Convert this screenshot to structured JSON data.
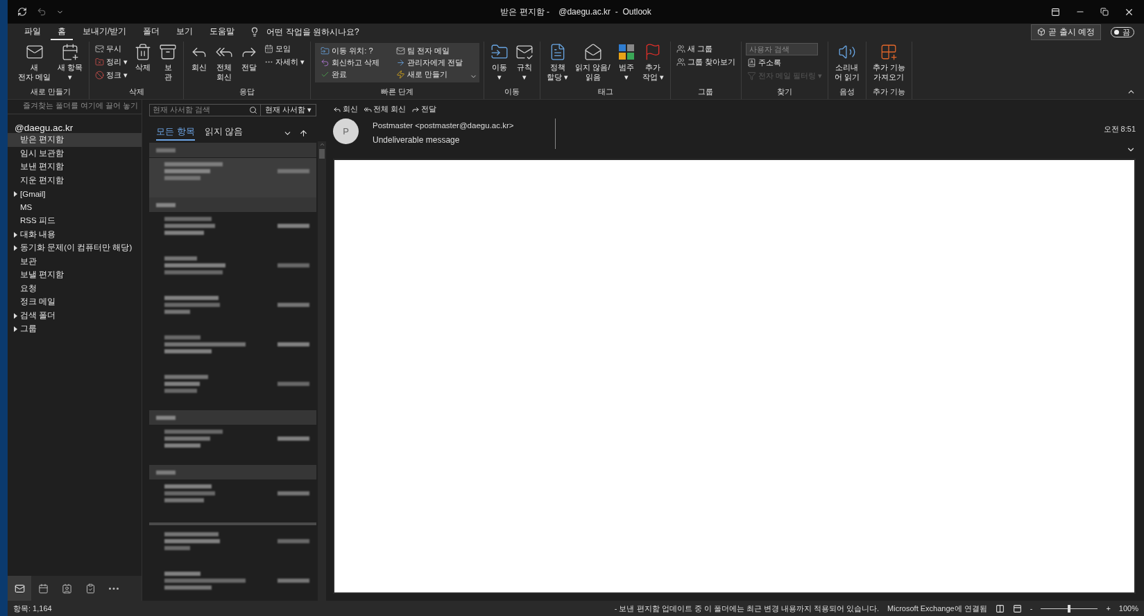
{
  "window": {
    "title": "받은 편지함 -    @daegu.ac.kr  -  Outlook"
  },
  "menu": [
    {
      "label": "파일",
      "selected": false
    },
    {
      "label": "홈",
      "selected": true
    },
    {
      "label": "보내기/받기",
      "selected": false
    },
    {
      "label": "폴더",
      "selected": false
    },
    {
      "label": "보기",
      "selected": false
    },
    {
      "label": "도움말",
      "selected": false
    }
  ],
  "tell_me": "어떤 작업을 원하시나요?",
  "coming_soon": {
    "label": "곧 출시 예정",
    "toggle_label": "끔",
    "on": false
  },
  "ribbon": [
    {
      "label": "새로 만들기",
      "items": [
        {
          "kind": "large",
          "label": "새\n전자 메일"
        },
        {
          "kind": "large",
          "label": "새 항목\n▾"
        }
      ]
    },
    {
      "label": "삭제",
      "items": [
        {
          "kind": "small",
          "label": "무시"
        },
        {
          "kind": "small",
          "label": "정리 ▾"
        },
        {
          "kind": "small",
          "label": "정크 ▾"
        },
        {
          "kind": "large",
          "label": "삭제"
        },
        {
          "kind": "large",
          "label": "보\n관"
        }
      ]
    },
    {
      "label": "응답",
      "items": [
        {
          "kind": "large",
          "label": "회신"
        },
        {
          "kind": "large",
          "label": "전체\n회신"
        },
        {
          "kind": "large",
          "label": "전달"
        },
        {
          "kind": "small",
          "label": "모임"
        },
        {
          "kind": "small",
          "label": "자세히 ▾"
        }
      ]
    },
    {
      "label": "빠른 단계",
      "items": [
        {
          "kind": "step",
          "label": "이동 위치: ?"
        },
        {
          "kind": "step",
          "label": "팀 전자 메일"
        },
        {
          "kind": "step",
          "label": "회신하고 삭제"
        },
        {
          "kind": "step",
          "label": "관리자에게 전달"
        },
        {
          "kind": "step",
          "label": "완료"
        },
        {
          "kind": "step",
          "label": "새로 만들기"
        }
      ]
    },
    {
      "label": "이동",
      "items": [
        {
          "kind": "large",
          "label": "이동\n▾"
        },
        {
          "kind": "large",
          "label": "규칙\n▾"
        }
      ]
    },
    {
      "label": "태그",
      "items": [
        {
          "kind": "large",
          "label": "정책\n할당 ▾"
        },
        {
          "kind": "large",
          "label": "읽지 않음/\n읽음"
        },
        {
          "kind": "large",
          "label": "범주\n▾"
        },
        {
          "kind": "large",
          "label": "추가\n작업 ▾"
        }
      ]
    },
    {
      "label": "그룹",
      "items": [
        {
          "kind": "small",
          "label": "새 그룹"
        },
        {
          "kind": "small",
          "label": "그룹 찾아보기"
        }
      ]
    },
    {
      "label": "찾기",
      "items": [
        {
          "kind": "search",
          "placeholder": "사용자 검색"
        },
        {
          "kind": "small",
          "label": "주소록",
          "disabled": false
        },
        {
          "kind": "small",
          "label": "전자 메일 필터링 ▾",
          "disabled": true
        }
      ]
    },
    {
      "label": "음성",
      "items": [
        {
          "kind": "large",
          "label": "소리내\n어 읽기"
        }
      ]
    },
    {
      "label": "추가 기능",
      "items": [
        {
          "kind": "large",
          "label": "추가 기능\n가져오기"
        }
      ]
    }
  ],
  "favorites_hint": "즐겨찾는 폴더를 여기에 끌어 놓기",
  "account": "@daegu.ac.kr",
  "folders": [
    {
      "label": "받은 편지함",
      "kind": "folder",
      "selected": true
    },
    {
      "label": "임시 보관함",
      "kind": "folder",
      "selected": false
    },
    {
      "label": "보낸 편지함",
      "kind": "folder",
      "selected": false
    },
    {
      "label": "지운 편지함",
      "kind": "folder",
      "selected": false
    },
    {
      "label": "[Gmail]",
      "kind": "group",
      "selected": false
    },
    {
      "label": "MS",
      "kind": "folder",
      "selected": false
    },
    {
      "label": "RSS 피드",
      "kind": "folder",
      "selected": false
    },
    {
      "label": "대화 내용",
      "kind": "group",
      "selected": false
    },
    {
      "label": "동기화 문제(이 컴퓨터만 해당)",
      "kind": "group",
      "selected": false
    },
    {
      "label": "보관",
      "kind": "folder",
      "selected": false
    },
    {
      "label": "보낼 편지함",
      "kind": "folder",
      "selected": false
    },
    {
      "label": "요청",
      "kind": "folder",
      "selected": false
    },
    {
      "label": "정크 메일",
      "kind": "folder",
      "selected": false
    },
    {
      "label": "검색 폴더",
      "kind": "group",
      "selected": false
    },
    {
      "label": "그룹",
      "kind": "group",
      "selected": false
    }
  ],
  "nav": [
    {
      "selected": true
    },
    {
      "selected": false
    },
    {
      "selected": false
    },
    {
      "selected": false
    },
    {
      "selected": false
    }
  ],
  "message_list": {
    "search_placeholder": "현재 사서함 검색",
    "scope": "현재 사서함 ▾",
    "tabs": [
      {
        "label": "모든 항목",
        "selected": true
      },
      {
        "label": "읽지 않음",
        "selected": false
      }
    ],
    "entries": [
      {
        "kind": "header"
      },
      {
        "kind": "message",
        "selected": true
      },
      {
        "kind": "header"
      },
      {
        "kind": "message",
        "selected": false
      },
      {
        "kind": "message",
        "selected": false
      },
      {
        "kind": "message",
        "selected": false
      },
      {
        "kind": "message",
        "selected": false
      },
      {
        "kind": "message",
        "selected": false
      },
      {
        "kind": "header"
      },
      {
        "kind": "message",
        "selected": false
      },
      {
        "kind": "header"
      },
      {
        "kind": "message",
        "selected": false
      },
      {
        "kind": "rule"
      },
      {
        "kind": "message",
        "selected": false
      },
      {
        "kind": "message",
        "selected": false
      }
    ]
  },
  "reading": {
    "actions": [
      "회신",
      "전체 회신",
      "전달"
    ],
    "avatar": "P",
    "sender": "Postmaster <postmaster@daegu.ac.kr>",
    "subject": "Undeliverable message",
    "time": "오전 8:51"
  },
  "status_bar": {
    "items": "항목: 1,164",
    "sync": "- 보낸 편지함 업데이트 중  이 폴더에는 최근 변경 내용까지 적용되어 있습니다.",
    "connection": "Microsoft Exchange에 연결됨",
    "zoom_minus": "-",
    "zoom_plus": "+",
    "zoom": {
      "level": 0.5
    },
    "zoom_text": "100%"
  }
}
